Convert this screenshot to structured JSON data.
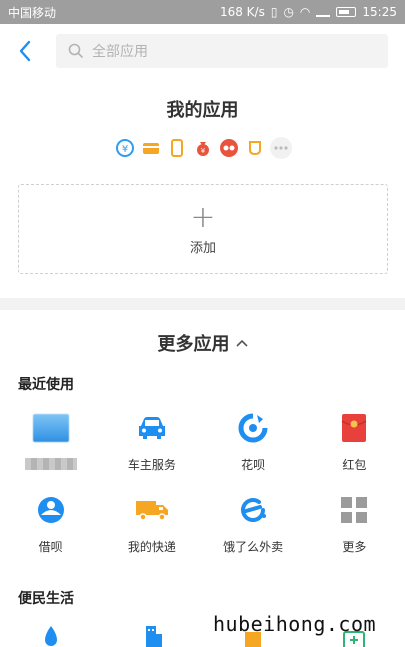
{
  "status_bar": {
    "carrier": "中国移动",
    "speed": "168 K/s",
    "battery_level": 0.5,
    "time": "15:25"
  },
  "search": {
    "placeholder": "全部应用"
  },
  "my_apps": {
    "title": "我的应用",
    "icons": [
      {
        "name": "yuebao-icon",
        "color": "#2a9df4"
      },
      {
        "name": "card-icon",
        "color": "#f5a623"
      },
      {
        "name": "phone-recharge-icon",
        "color": "#f5a623"
      },
      {
        "name": "money-bag-icon",
        "color": "#e8553d"
      },
      {
        "name": "glasses-icon",
        "color": "#e8553d"
      },
      {
        "name": "cup-icon",
        "color": "#f5a623"
      },
      {
        "name": "more-dots-icon",
        "color": "#cccccc"
      }
    ],
    "add_label": "添加",
    "add_symbol": "+"
  },
  "more_apps": {
    "title": "更多应用",
    "chevron": "^"
  },
  "recent": {
    "title": "最近使用",
    "row1": [
      {
        "label": "",
        "icon": "blurred-app-icon"
      },
      {
        "label": "车主服务",
        "icon": "car-icon",
        "color": "#1f8ef1"
      },
      {
        "label": "花呗",
        "icon": "huabei-icon",
        "color": "#1f8ef1"
      },
      {
        "label": "红包",
        "icon": "red-envelope-icon",
        "color": "#e8413c"
      }
    ],
    "row2": [
      {
        "label": "借呗",
        "icon": "jiebei-icon",
        "color": "#1f8ef1"
      },
      {
        "label": "我的快递",
        "icon": "truck-icon",
        "color": "#f5a623"
      },
      {
        "label": "饿了么外卖",
        "icon": "eleme-icon",
        "color": "#1f8ef1"
      },
      {
        "label": "更多",
        "icon": "grid-more-icon",
        "color": "#9b9b9b"
      }
    ]
  },
  "life": {
    "title": "便民生活"
  },
  "watermark": "hubeihong.com",
  "colors": {
    "accent": "#1f8ef1",
    "status_bg": "#9e9e9e"
  }
}
